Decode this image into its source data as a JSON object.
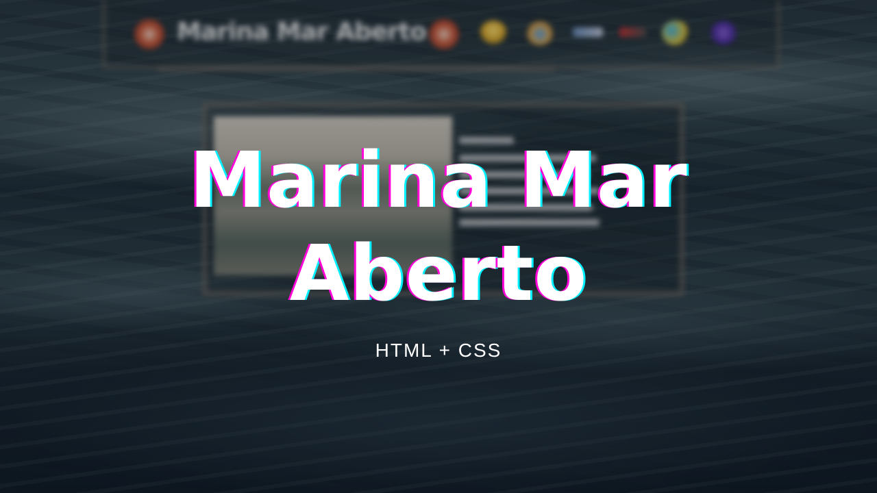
{
  "background": {
    "site_preview": {
      "brand_name": "Marina Mar Aberto",
      "tech_icons": [
        "html-icon",
        "bulb-icon",
        "flask-icon",
        "css-bar-icon",
        "ruby-bar-icon",
        "js-icon",
        "react-icon"
      ]
    }
  },
  "title": {
    "line1": "Marina Mar",
    "line2": "Aberto"
  },
  "subtitle": "HTML + CSS",
  "colors": {
    "title_text": "#ffffff",
    "glitch_left": "#ff00d8",
    "glitch_right": "#00f0ff",
    "ocean_dark": "#0d1722"
  }
}
